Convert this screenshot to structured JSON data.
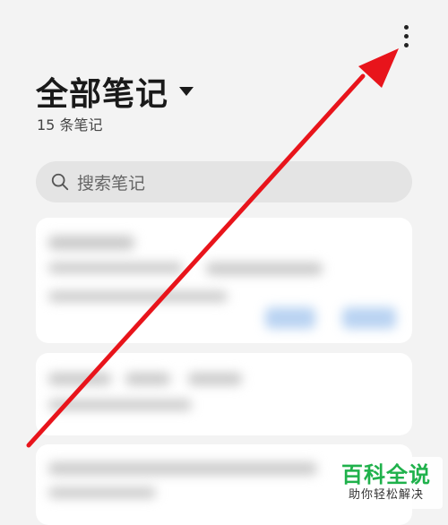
{
  "header": {
    "more_icon": "vertical-ellipsis-icon",
    "title": "全部笔记",
    "title_dropdown_icon": "caret-down-icon",
    "count": "15 条笔记"
  },
  "search": {
    "icon": "search-icon",
    "placeholder": "搜索笔记"
  },
  "notes": [
    {
      "state": "blurred"
    },
    {
      "state": "blurred"
    },
    {
      "state": "blurred"
    }
  ],
  "annotation": {
    "type": "arrow",
    "color": "#e8141b",
    "points_to": "more-options-button"
  },
  "watermark": {
    "title": "百科全说",
    "subtitle": "助你轻松解决",
    "title_color": "#1fb14b"
  },
  "colors": {
    "background": "#f3f3f3",
    "search_bar": "#e4e4e4",
    "card": "#ffffff"
  }
}
